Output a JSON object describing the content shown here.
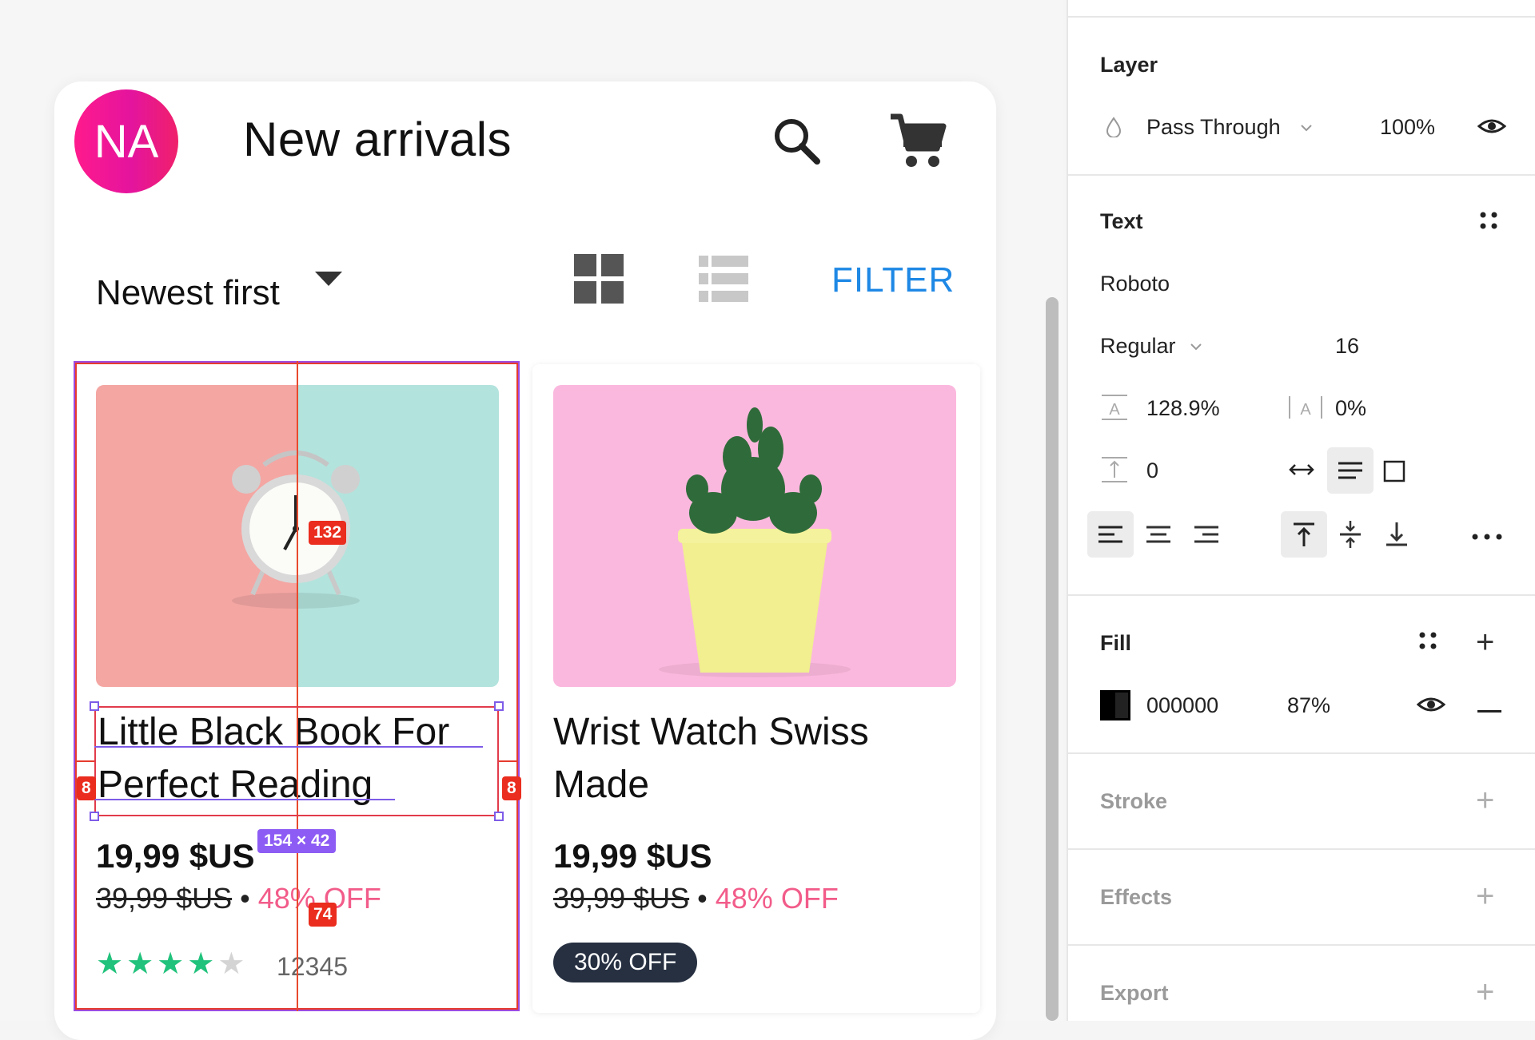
{
  "app": {
    "avatar_initials": "NA",
    "title": "New arrivals",
    "sort_label": "Newest first",
    "filter_label": "FILTER"
  },
  "products": [
    {
      "title_line1": "Little Black Book For",
      "title_line2": "Perfect Reading",
      "price": "19,99 $US",
      "old_price": "39,99 $US",
      "separator": "•",
      "discount": "48% OFF",
      "rating": 4,
      "rating_max": 5,
      "review_count": "12345",
      "image": "alarm-clock-photo"
    },
    {
      "title_line1": "Wrist Watch Swiss",
      "title_line2": "Made",
      "price": "19,99 $US",
      "old_price": "39,99 $US",
      "separator": "•",
      "discount": "48% OFF",
      "badge": "30% OFF",
      "image": "potted-plant-photo"
    }
  ],
  "overlays": {
    "measure_top": "132",
    "measure_left": "8",
    "measure_right": "8",
    "measure_bottom": "74",
    "dimensions": "154 × 42"
  },
  "panel": {
    "layer": {
      "title": "Layer",
      "blend_mode": "Pass Through",
      "opacity": "100%"
    },
    "text": {
      "title": "Text",
      "font_family": "Roboto",
      "font_weight": "Regular",
      "font_size": "16",
      "line_height": "128.9%",
      "letter_spacing": "0%",
      "paragraph_spacing": "0"
    },
    "fill": {
      "title": "Fill",
      "color_hex": "000000",
      "opacity": "87%"
    },
    "stroke": {
      "title": "Stroke"
    },
    "effects": {
      "title": "Effects"
    },
    "export": {
      "title": "Export"
    }
  },
  "colors": {
    "accent_blue": "#1e88e5",
    "discount_pink": "#f25c8a",
    "star_green": "#21c27c",
    "selection_red": "#e63b2e",
    "selection_purple": "#8d5cf4",
    "avatar_pink": "#ff1a8c"
  }
}
